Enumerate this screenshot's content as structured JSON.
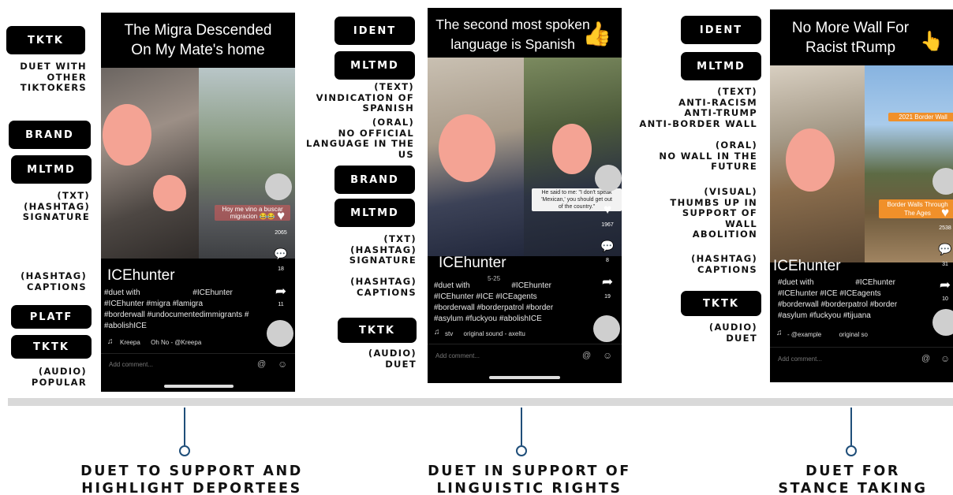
{
  "columns": [
    {
      "tags": [
        {
          "id": "c1-tktk",
          "text": "TKTK"
        },
        {
          "id": "c1-brand",
          "text": "BRAND"
        },
        {
          "id": "c1-mltmd",
          "text": "MLTMD"
        },
        {
          "id": "c1-platf",
          "text": "PLATF"
        },
        {
          "id": "c1-tktk2",
          "text": "TKTK"
        }
      ],
      "notes": [
        "DUET WITH\nOTHER\nTIKTOKERS",
        "(TXT)\n(HASHTAG)\nSIGNATURE",
        "(HASHTAG)\nCAPTIONS",
        "(AUDIO)\nPOPULAR"
      ],
      "phone": {
        "title": "The Migra Descended\nOn My Mate's home",
        "overlay_text": "Hoy me vino a buscar\nmigracion 😂😂",
        "like_count": "2065",
        "comment_count": "18",
        "share_count": "11",
        "handle": "ICEhunter",
        "caption": "#duet with                        #ICEhunter\n#ICEhunter #migra #lamigra\n#borderwall #undocumentedimmigrants #\n#abolishICE",
        "sound_icon": "♫",
        "sound": "Kreepa      Oh No - @Kreepa",
        "comment_placeholder": "Add comment..."
      },
      "outcome": "DUET TO SUPPORT AND\nHIGHLIGHT DEPORTEES"
    },
    {
      "tags": [
        {
          "id": "c2-ident",
          "text": "IDENT"
        },
        {
          "id": "c2-mltmd",
          "text": "MLTMD"
        },
        {
          "id": "c2-brand",
          "text": "BRAND"
        },
        {
          "id": "c2-mltmd2",
          "text": "MLTMD"
        },
        {
          "id": "c2-tktk",
          "text": "TKTK"
        }
      ],
      "notes": [
        "(TEXT)\nVINDICATION OF\nSPANISH",
        "(ORAL)\nNO OFFICIAL\nLANGUAGE IN THE\nUS",
        "(TXT)\n(HASHTAG)\nSIGNATURE",
        "(HASHTAG)\nCAPTIONS",
        "(AUDIO)\nDUET"
      ],
      "phone": {
        "title": "The second most spoken\nlanguage is Spanish",
        "overlay_text": "He said to me: \"I don't speak\n'Mexican,' you should get out\nof the country.\"",
        "like_count": "1967",
        "comment_count": "8",
        "share_count": "19",
        "timestamp": "5-25",
        "handle": "ICEhunter",
        "caption": "#duet with                   #ICEhunter\n#ICEhunter #ICE #ICEagents\n#borderwall #borderpatrol #border\n#asylum #fuckyou #abolishICE",
        "sound_icon": "♫",
        "sound": "stv      original sound - axeltu",
        "comment_placeholder": "Add comment..."
      },
      "outcome": "DUET IN SUPPORT OF\nLINGUISTIC RIGHTS"
    },
    {
      "tags": [
        {
          "id": "c3-ident",
          "text": "IDENT"
        },
        {
          "id": "c3-mltmd",
          "text": "MLTMD"
        },
        {
          "id": "c3-tktk",
          "text": "TKTK"
        }
      ],
      "notes": [
        "(TEXT)\nANTI-RACISM\nANTI-TRUMP\nANTI-BORDER WALL",
        "(ORAL)\nNO WALL IN THE\nFUTURE",
        "(VISUAL)\nTHUMBS UP IN\nSUPPORT OF\nWALL\nABOLITION",
        "(HASHTAG)\nCAPTIONS",
        "(AUDIO)\nDUET"
      ],
      "phone": {
        "title": "No More Wall For\nRacist tRump",
        "overlay_top": "2021 Border Wall",
        "overlay_bottom": "Border Walls Through\nThe Ages",
        "like_count": "2538",
        "comment_count": "31",
        "share_count": "10",
        "handle": "ICEhunter",
        "caption": "#duet with                   #ICEhunter\n#ICEhunter #ICE #ICEagents\n#borderwall #borderpatrol #border\n#asylum #fuckyou #tijuana",
        "sound_icon": "♫",
        "sound": "- @example          original so",
        "comment_placeholder": "Add comment..."
      },
      "outcome": "DUET FOR\nSTANCE TAKING"
    }
  ],
  "icons": {
    "heart": "♥",
    "comment": "💬",
    "share": "➦",
    "thumbs_up": "👍",
    "pointing_finger": "👆",
    "at": "@",
    "emoji": "☺"
  },
  "colors": {
    "tag_bg": "#000000",
    "timeline": "#d9d9d9",
    "connector": "#1f4e79",
    "face_blur": "#f4a394"
  }
}
